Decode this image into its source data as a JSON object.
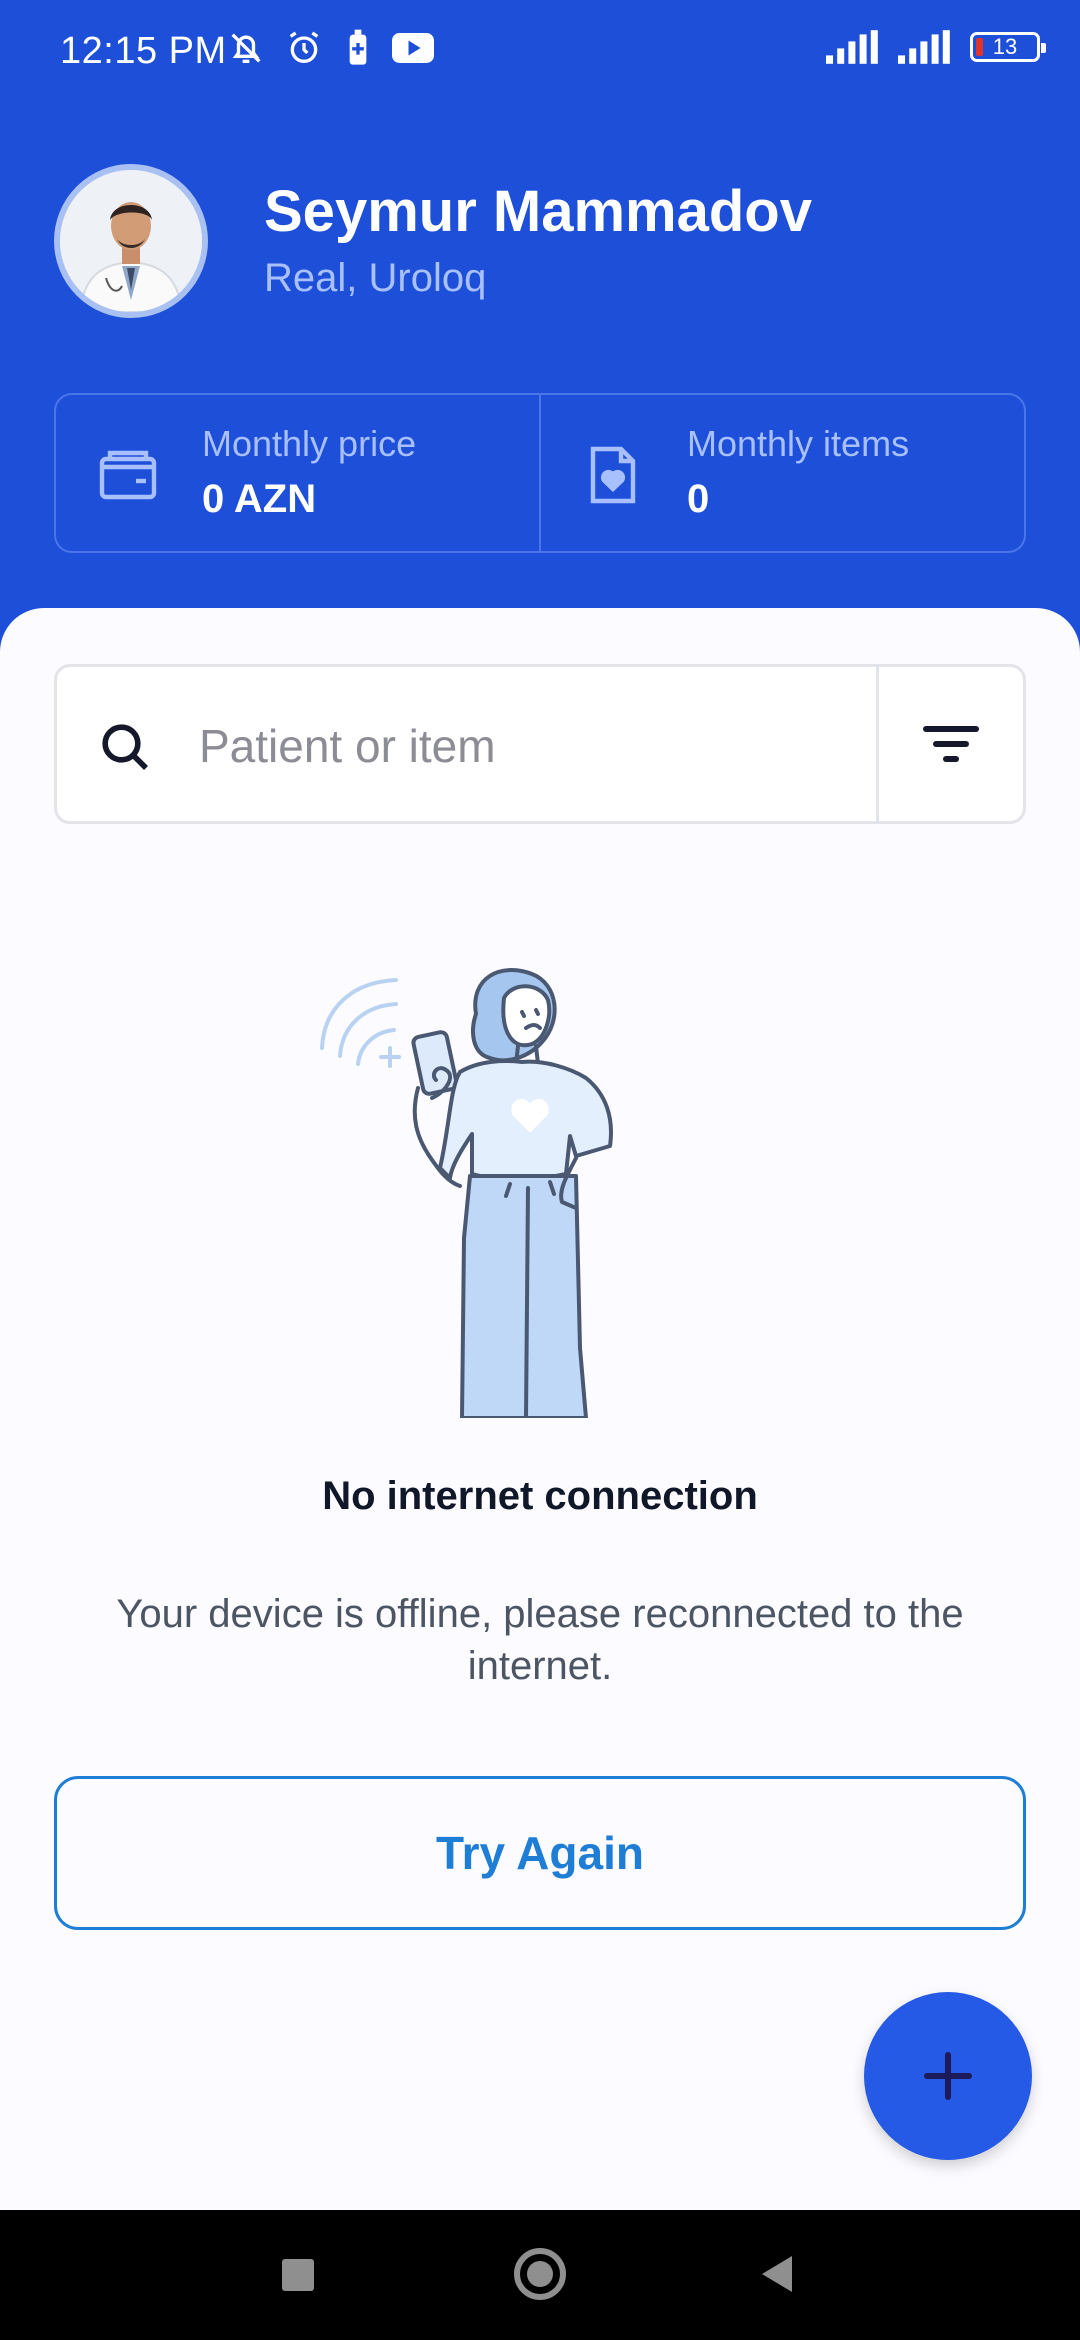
{
  "status_bar": {
    "time": "12:15 PM",
    "battery_level": "13",
    "icons": [
      "mute-bell-icon",
      "alarm-icon",
      "battery-saver-icon",
      "youtube-icon",
      "signal-icon",
      "signal-icon",
      "battery-icon"
    ]
  },
  "profile": {
    "name": "Seymur Mammadov",
    "subtitle": "Real, Uroloq"
  },
  "stats": [
    {
      "label": "Monthly price",
      "value": "0 AZN",
      "icon": "wallet-icon"
    },
    {
      "label": "Monthly items",
      "value": "0",
      "icon": "document-heart-icon"
    }
  ],
  "search": {
    "placeholder": "Patient or item"
  },
  "empty_state": {
    "title": "No internet connection",
    "description": "Your device is offline, please reconnected to the internet.",
    "button_label": "Try Again"
  },
  "colors": {
    "header_bg": "#1e4fd8",
    "accent": "#1e7ed6",
    "fab": "#245ae6",
    "sheet_bg": "#fcfbff"
  }
}
